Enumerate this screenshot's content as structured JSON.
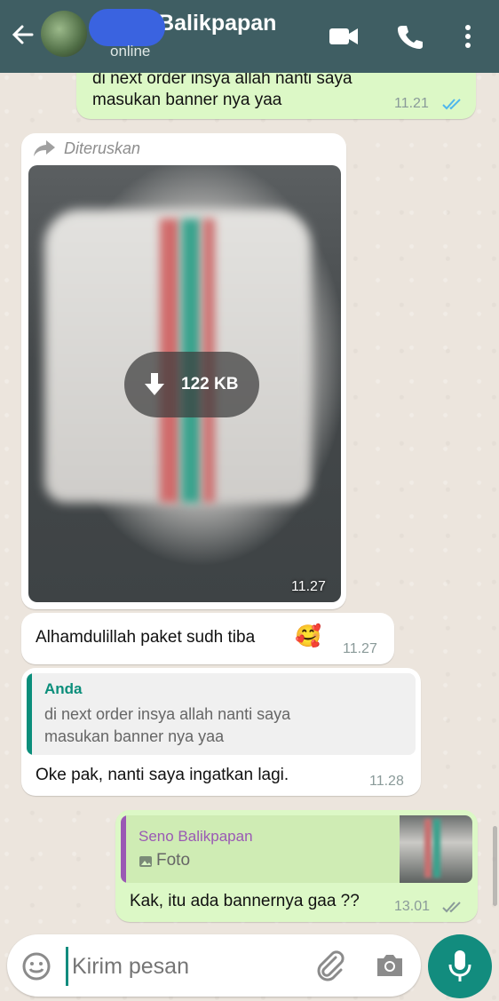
{
  "header": {
    "contact_name": "Seno Balikpapan",
    "status": "online"
  },
  "messages": [
    {
      "id": "m1",
      "direction": "out",
      "text_line1": "di next order insya allah nanti saya",
      "text_line2": "masukan banner nya yaa",
      "time": "11.21",
      "status": "read"
    },
    {
      "id": "m2",
      "direction": "in",
      "forwarded_label": "Diteruskan",
      "download_size": "122 KB",
      "time": "11.27"
    },
    {
      "id": "m3",
      "direction": "in",
      "text": "Alhamdulillah paket sudh tiba",
      "emoji": "🥰",
      "time": "11.27"
    },
    {
      "id": "m4",
      "direction": "in",
      "quote_author": "Anda",
      "quote_line1": "di next order insya allah nanti saya",
      "quote_line2": "masukan banner nya yaa",
      "text": "Oke pak, nanti saya ingatkan lagi.",
      "time": "11.28"
    },
    {
      "id": "m5",
      "direction": "out",
      "quote_author": "Seno Balikpapan",
      "quote_type": "Foto",
      "text": "Kak, itu ada bannernya gaa ??",
      "time": "13.01",
      "status": "delivered"
    }
  ],
  "input": {
    "placeholder": "Kirim pesan"
  },
  "colors": {
    "header_bg": "#3f5e63",
    "outgoing_bubble": "#dcf8c6",
    "incoming_bubble": "#ffffff",
    "read_ticks": "#4fb6ec",
    "quote_self_bar": "#0b8e7b",
    "quote_other_bar": "#9a59b4",
    "mic_button": "#128c7e"
  },
  "icons": [
    "back-arrow-icon",
    "video-call-icon",
    "phone-icon",
    "more-vert-icon",
    "forward-icon",
    "download-icon",
    "emoji-icon",
    "attach-icon",
    "camera-icon",
    "mic-icon",
    "photo-icon"
  ]
}
